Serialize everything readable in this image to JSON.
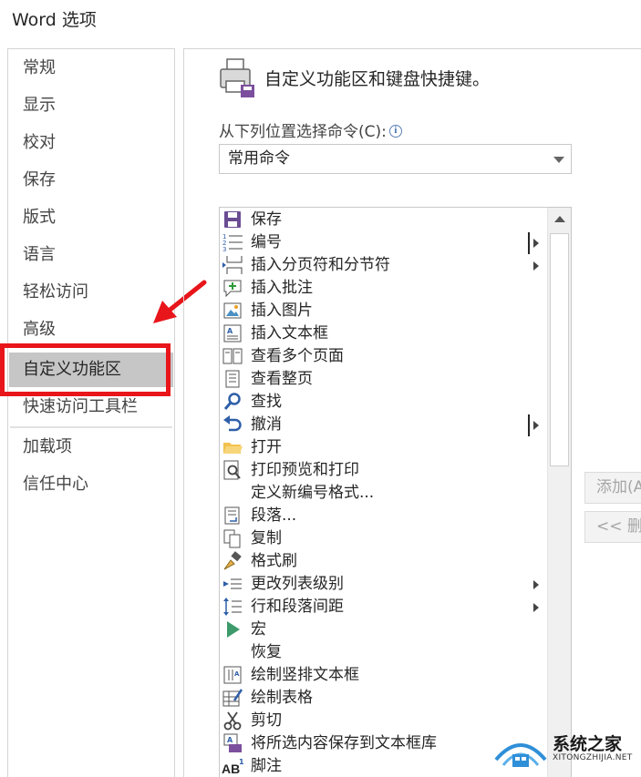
{
  "window": {
    "title": "Word 选项"
  },
  "nav": {
    "items": [
      {
        "label": "常规"
      },
      {
        "label": "显示"
      },
      {
        "label": "校对"
      },
      {
        "label": "保存"
      },
      {
        "label": "版式"
      },
      {
        "label": "语言"
      },
      {
        "label": "轻松访问"
      },
      {
        "label": "高级"
      },
      {
        "label": "自定义功能区",
        "selected": true
      },
      {
        "label": "快速访问工具栏"
      },
      {
        "label": "加载项"
      },
      {
        "label": "信任中心"
      }
    ]
  },
  "annotation": {
    "highlight_color": "#e8151a",
    "arrow_color": "#e8151a"
  },
  "panel": {
    "header": "自定义功能区和键盘快捷键。",
    "choose_label": "从下列位置选择命令(C):",
    "combo_value": "常用命令",
    "commands": [
      {
        "icon": "save-icon",
        "label": "保存"
      },
      {
        "icon": "numbering-icon",
        "label": "编号",
        "submenu": true,
        "split": true
      },
      {
        "icon": "page-break-icon",
        "label": "插入分页符和分节符",
        "submenu": true
      },
      {
        "icon": "comment-icon",
        "label": "插入批注"
      },
      {
        "icon": "picture-icon",
        "label": "插入图片"
      },
      {
        "icon": "textbox-icon",
        "label": "插入文本框"
      },
      {
        "icon": "multiple-pages-icon",
        "label": "查看多个页面"
      },
      {
        "icon": "whole-page-icon",
        "label": "查看整页"
      },
      {
        "icon": "search-icon",
        "label": "查找"
      },
      {
        "icon": "undo-icon",
        "label": "撤消",
        "submenu": true,
        "split": true
      },
      {
        "icon": "folder-icon",
        "label": "打开"
      },
      {
        "icon": "print-preview-icon",
        "label": "打印预览和打印"
      },
      {
        "icon": "",
        "label": "定义新编号格式..."
      },
      {
        "icon": "paragraph-icon",
        "label": "段落..."
      },
      {
        "icon": "copy-icon",
        "label": "复制"
      },
      {
        "icon": "format-painter-icon",
        "label": "格式刷"
      },
      {
        "icon": "list-level-icon",
        "label": "更改列表级别",
        "submenu": true
      },
      {
        "icon": "line-spacing-icon",
        "label": "行和段落间距",
        "submenu": true
      },
      {
        "icon": "macro-icon",
        "label": "宏"
      },
      {
        "icon": "",
        "label": "恢复"
      },
      {
        "icon": "vertical-textbox-icon",
        "label": "绘制竖排文本框"
      },
      {
        "icon": "draw-table-icon",
        "label": "绘制表格"
      },
      {
        "icon": "cut-icon",
        "label": "剪切"
      },
      {
        "icon": "quick-parts-icon",
        "label": "将所选内容保存到文本框库"
      },
      {
        "icon": "footnote-icon",
        "label": "脚注"
      }
    ],
    "add_button": "添加(A",
    "remove_button": "<< 删"
  },
  "watermark": {
    "name": "系统之家",
    "url": "XITONGZHIJIA.NET"
  }
}
